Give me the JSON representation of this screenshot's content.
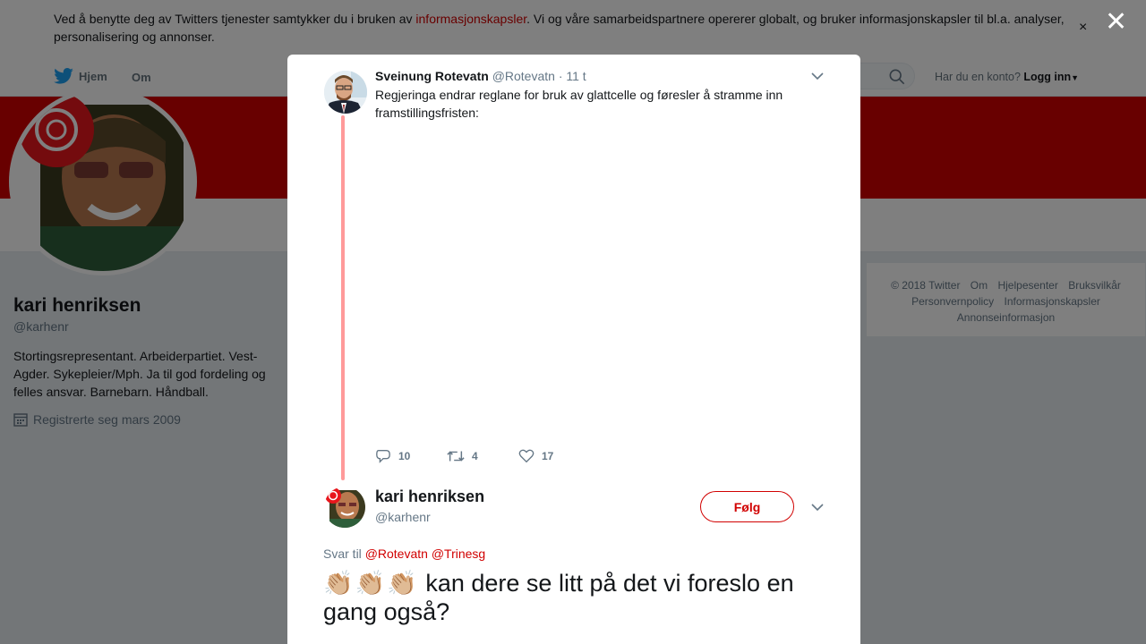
{
  "cookie": {
    "text_before": "Ved å benytte deg av Twitters tjenester samtykker du i bruken av ",
    "link": "informasjonskapsler",
    "text_after": ". Vi og våre samarbeidspartnere opererer globalt, og bruker informasjonskapsler til bl.a. analyser, personalisering og annonser.",
    "close": "×"
  },
  "nav": {
    "home": "Hjem",
    "about": "Om",
    "account_question": "Har du en konto?",
    "login": "Logg inn"
  },
  "profile": {
    "name": "kari henriksen",
    "handle": "@karhenr",
    "bio": "Stortingsrepresentant. Arbeiderpartiet. Vest-Agder. Sykepleier/Mph. Ja til god fordeling og felles ansvar. Barnebarn. Håndball.",
    "joined": "Registrerte seg mars 2009"
  },
  "footer": {
    "links": [
      "© 2018 Twitter",
      "Om",
      "Hjelpesenter",
      "Bruksvilkår",
      "Personvernpolicy",
      "Informasjonskapsler",
      "Annonseinformasjon"
    ]
  },
  "overlay": {
    "close": "✕"
  },
  "tweet1": {
    "name": "Sveinung Rotevatn",
    "handle": "@Rotevatn",
    "time": "· 11 t",
    "text": "Regjeringa endrar reglane for bruk av glattcelle og føresler å stramme inn framstillingsfristen:",
    "replies": "10",
    "retweets": "4",
    "likes": "17"
  },
  "tweet2": {
    "name": "kari henriksen",
    "handle": "@karhenr",
    "follow": "Følg",
    "reply_prefix": "Svar til",
    "reply_mentions": "@Rotevatn @Trinesg",
    "claps": "👏🏼👏🏼👏🏼",
    "text": " kan dere se litt på det vi foreslo en gang også?"
  },
  "colors": {
    "accent": "#d10000",
    "thread": "#ff9a9a",
    "muted": "#657786"
  }
}
